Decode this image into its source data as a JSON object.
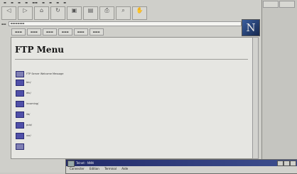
{
  "content": {
    "heading": "FTP Menu",
    "entries": [
      {
        "label": "FTP Server Welcome Message"
      },
      {
        "label": "bin/"
      },
      {
        "label": "etc/"
      },
      {
        "label": "incoming/"
      },
      {
        "label": "lib/"
      },
      {
        "label": "pub/"
      },
      {
        "label": "usr/"
      }
    ]
  },
  "telnet_window": {
    "title": "Telnet - NNN",
    "menu": [
      "Connecter",
      "Edition",
      "Terminal",
      "Aide"
    ]
  }
}
